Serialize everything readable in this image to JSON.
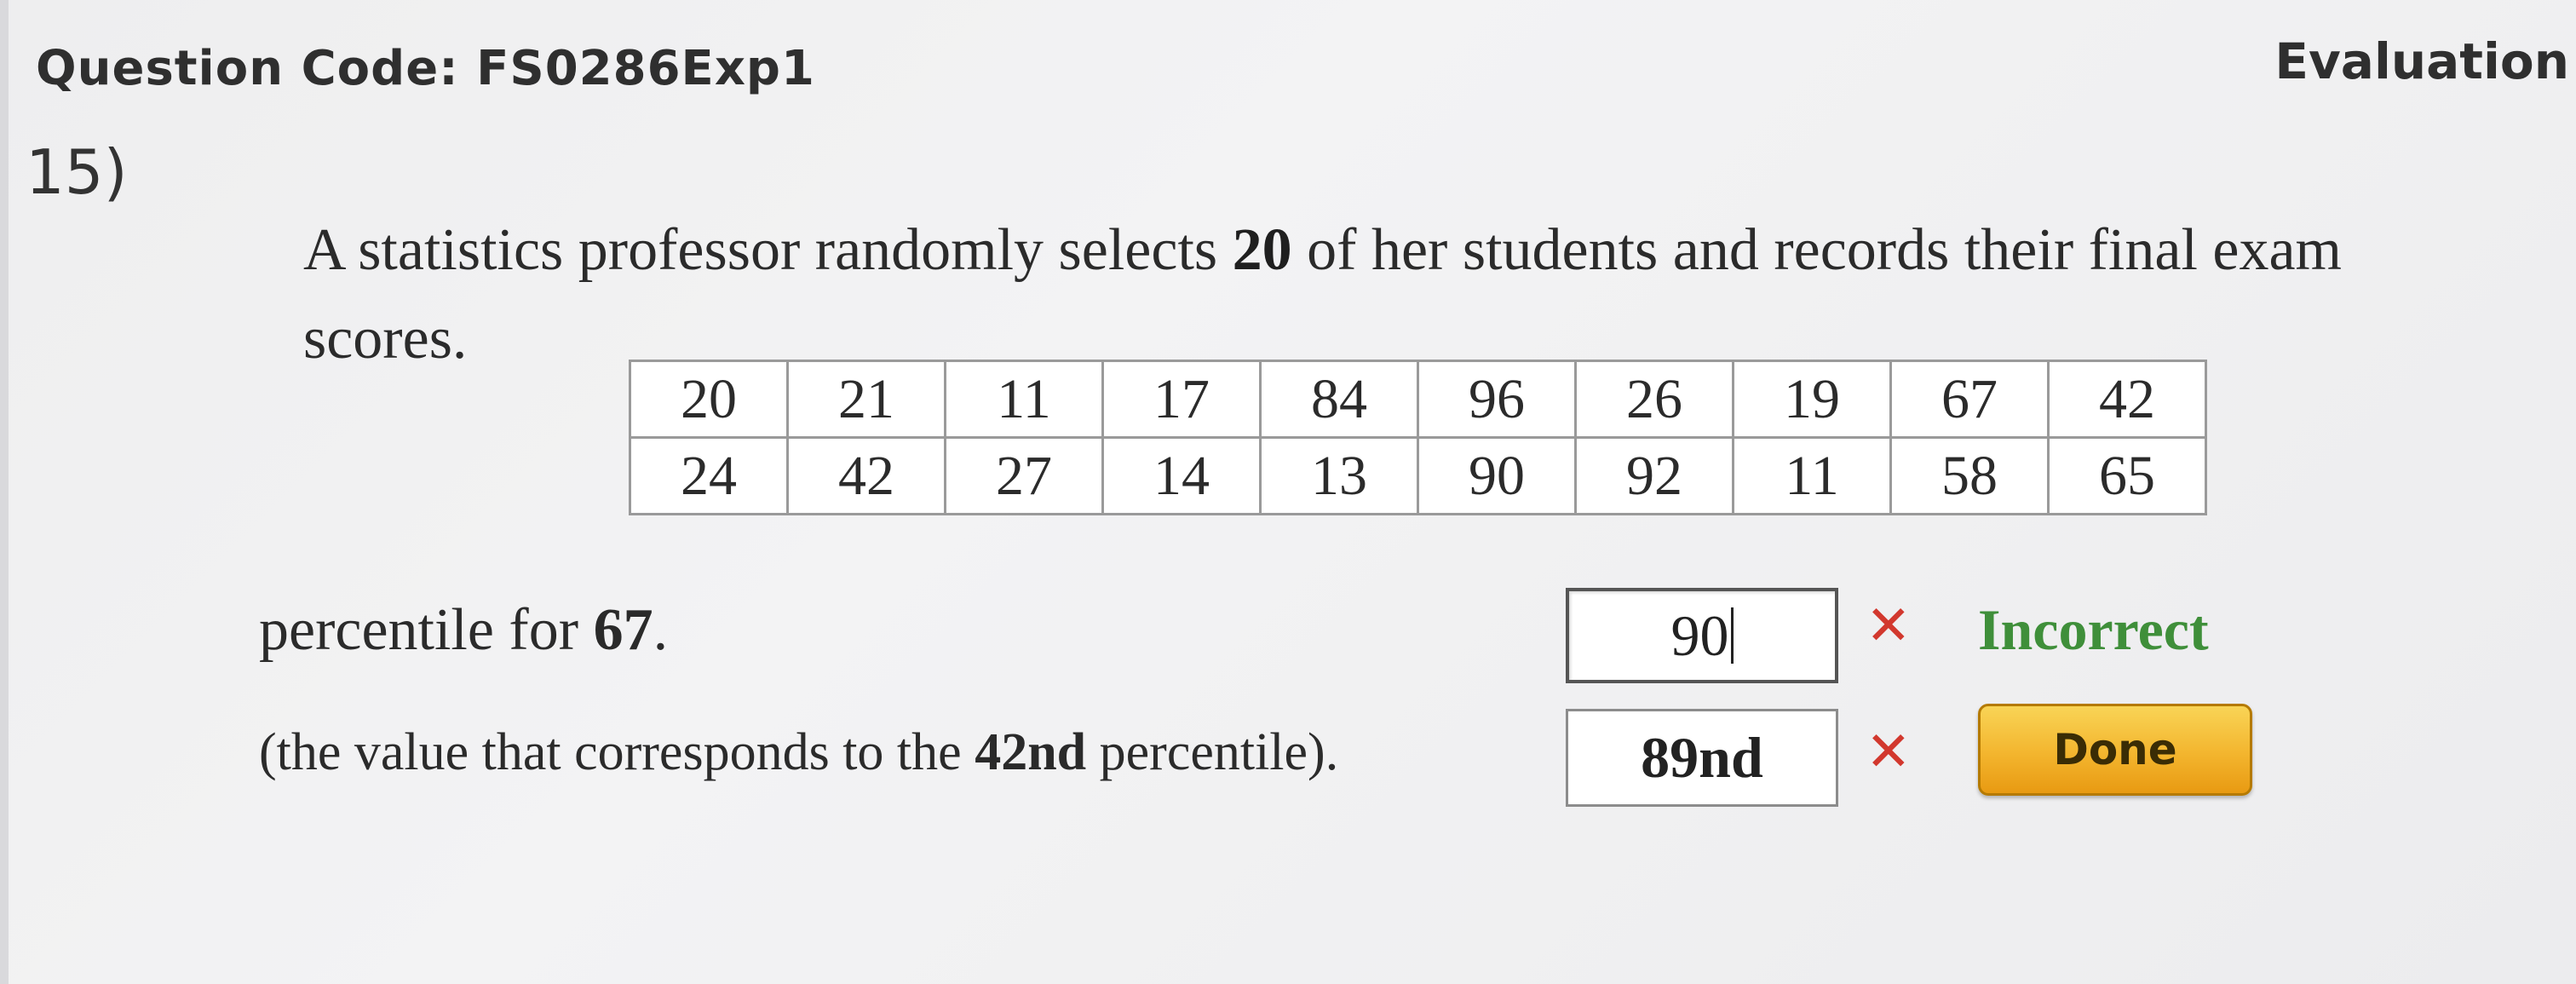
{
  "header": {
    "question_code": "Question Code: FS0286Exp1",
    "evaluation": "Evaluation"
  },
  "question": {
    "number": "15)",
    "text_before": "A statistics professor randomly selects ",
    "sample_size": "20",
    "text_after": " of her students and records their final exam scores."
  },
  "scores_table": [
    [
      "20",
      "21",
      "11",
      "17",
      "84",
      "96",
      "26",
      "19",
      "67",
      "42"
    ],
    [
      "24",
      "42",
      "27",
      "14",
      "13",
      "90",
      "92",
      "11",
      "58",
      "65"
    ]
  ],
  "part1": {
    "prompt_before": "percentile for ",
    "value": "67",
    "prompt_after": ".",
    "answer": "90",
    "status_mark": "✕",
    "status_text": "Incorrect"
  },
  "part2": {
    "prompt_before": "(the value that corresponds to the ",
    "percentile": "42nd",
    "prompt_after": " percentile).",
    "answer": "89nd",
    "status_mark": "✕"
  },
  "done_label": "Done",
  "colors": {
    "error_red": "#d2382e",
    "incorrect_green": "#3f8f3a",
    "done_button": "#f3b52e"
  }
}
